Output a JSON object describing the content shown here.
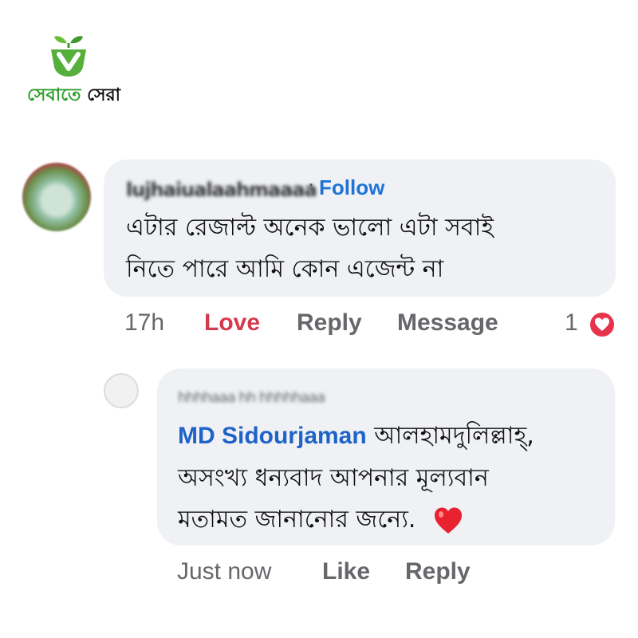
{
  "logo": {
    "text_green": "সেবাতে",
    "text_dark": "সেরা",
    "colors": {
      "green": "#2e9e2a",
      "dark": "#111111"
    }
  },
  "comment": {
    "author_name": "lujhaiualaahmaaaa",
    "separator": "·",
    "follow_label": "Follow",
    "text_lines": [
      "এটার রেজাল্ট অনেক ভালো এটা সবাই",
      "নিতে পারে আমি কোন এজেন্ট না"
    ],
    "actions": {
      "time": "17h",
      "love": "Love",
      "reply": "Reply",
      "message": "Message"
    },
    "reaction_count": "1"
  },
  "reply": {
    "author_subtitle": "hhhhaaa hh hhhhhaaa",
    "mention": "MD Sidourjaman",
    "line1_text": "আলহামদুলিল্লাহ্‌,",
    "text_lines": [
      "অসংখ্য ধন্যবাদ আপনার মূল্যবান",
      "মতামত জানানোর জন্যে."
    ],
    "actions": {
      "time": "Just now",
      "like": "Like",
      "reply": "Reply"
    }
  },
  "colors": {
    "bubble_bg": "#eff1f5",
    "link_blue": "#1f73d6",
    "love_red": "#d33a4c",
    "muted": "#65676b"
  }
}
